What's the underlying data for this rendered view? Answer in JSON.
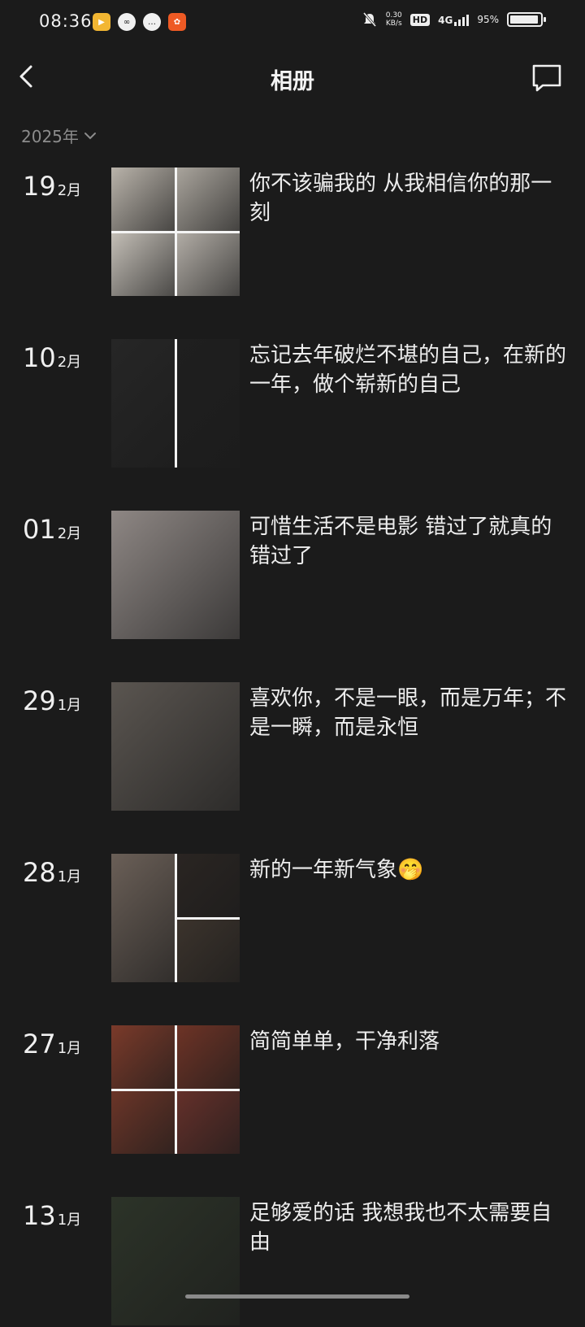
{
  "status_bar": {
    "time": "08:36",
    "net_speed_value": "0.30",
    "net_speed_unit": "KB/s",
    "hd": "HD",
    "network": "4G",
    "battery_text": "95%",
    "battery_level": 0.95
  },
  "header": {
    "title": "相册"
  },
  "year_filter": {
    "label": "2025年"
  },
  "entries": [
    {
      "day": "19",
      "month": "2月",
      "caption": "你不该骗我的 从我相信你的那一刻",
      "layout": "grid4",
      "colors": [
        "#b9b3aa",
        "#a9a49c",
        "#c3beb6",
        "#b1aca5"
      ]
    },
    {
      "day": "10",
      "month": "2月",
      "caption": "忘记去年破烂不堪的自己，在新的一年，做个崭新的自己",
      "layout": "split2",
      "colors": [
        "#262626",
        "#1f1f1f"
      ]
    },
    {
      "day": "01",
      "month": "2月",
      "caption": "可惜生活不是电影 错过了就真的错过了",
      "layout": "single",
      "colors": [
        "#8e8784"
      ]
    },
    {
      "day": "29",
      "month": "1月",
      "caption": "喜欢你，不是一眼，而是万年；不是一瞬，而是永恒",
      "layout": "single",
      "colors": [
        "#5a5550"
      ]
    },
    {
      "day": "28",
      "month": "1月",
      "caption": "新的一年新气象🤭",
      "layout": "split3",
      "colors": [
        "#6a5f57",
        "#2a2522",
        "#3b332c"
      ]
    },
    {
      "day": "27",
      "month": "1月",
      "caption": "简简单单，干净利落",
      "layout": "grid4",
      "colors": [
        "#7a3a2a",
        "#6d3326",
        "#6b3528",
        "#64302a"
      ]
    },
    {
      "day": "13",
      "month": "1月",
      "caption": "足够爱的话 我想我也不太需要自由",
      "layout": "single",
      "colors": [
        "#2c3328"
      ]
    }
  ]
}
